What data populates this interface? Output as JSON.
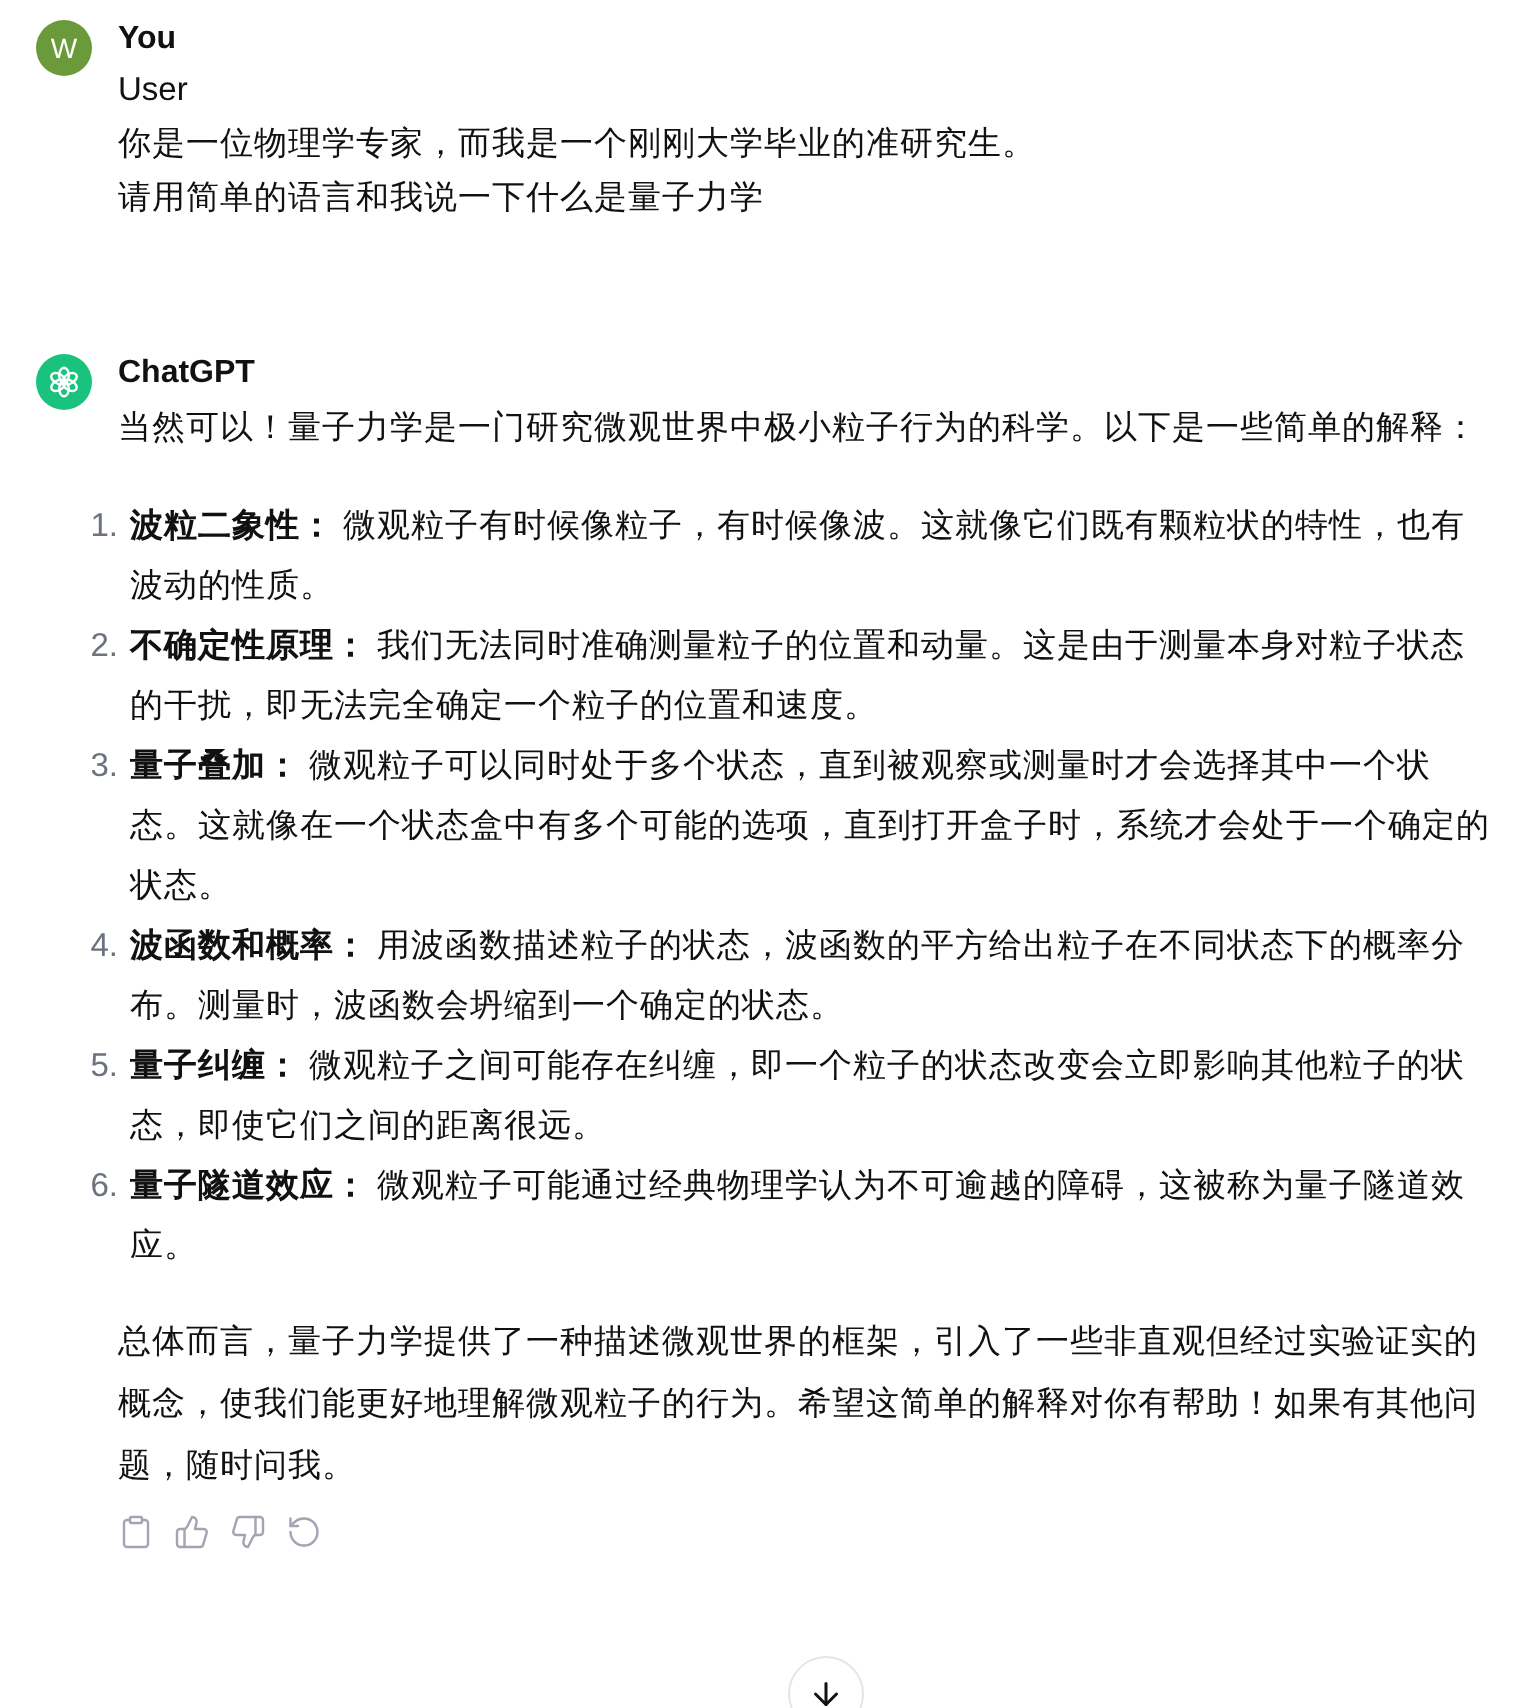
{
  "messages": [
    {
      "author": "You",
      "avatar_letter": "W",
      "kind": "user",
      "role_label": "User",
      "lines": [
        "你是一位物理学专家，而我是一个刚刚大学毕业的准研究生。",
        "请用简单的语言和我说一下什么是量子力学"
      ]
    },
    {
      "author": "ChatGPT",
      "kind": "assistant",
      "intro": "当然可以！量子力学是一门研究微观世界中极小粒子行为的科学。以下是一些简单的解释：",
      "list": [
        {
          "number": "1.",
          "text": "**波粒二象性：** 微观粒子有时候像粒子，有时候像波。这就像它们既有颗粒状的特性，也有波动的性质。"
        },
        {
          "number": "2.",
          "text": "**不确定性原理：** 我们无法同时准确测量粒子的位置和动量。这是由于测量本身对粒子状态的干扰，即无法完全确定一个粒子的位置和速度。"
        },
        {
          "number": "3.",
          "text": "**量子叠加：** 微观粒子可以同时处于多个状态，直到被观察或测量时才会选择其中一个状态。这就像在一个状态盒中有多个可能的选项，直到打开盒子时，系统才会处于一个确定的状态。"
        },
        {
          "number": "4.",
          "text": "**波函数和概率：** 用波函数描述粒子的状态，波函数的平方给出粒子在不同状态下的概率分布。测量时，波函数会坍缩到一个确定的状态。"
        },
        {
          "number": "5.",
          "text": "**量子纠缠：** 微观粒子之间可能存在纠缠，即一个粒子的状态改变会立即影响其他粒子的状态，即使它们之间的距离很远。"
        },
        {
          "number": "6.",
          "text": "**量子隧道效应：** 微观粒子可能通过经典物理学认为不可逾越的障碍，这被称为量子隧道效应。"
        }
      ],
      "conclusion": "总体而言，量子力学提供了一种描述微观世界的框架，引入了一些非直观但经过实验证实的概念，使我们能更好地理解微观粒子的行为。希望这简单的解释对你有帮助！如果有其他问题，随时问我。"
    }
  ]
}
